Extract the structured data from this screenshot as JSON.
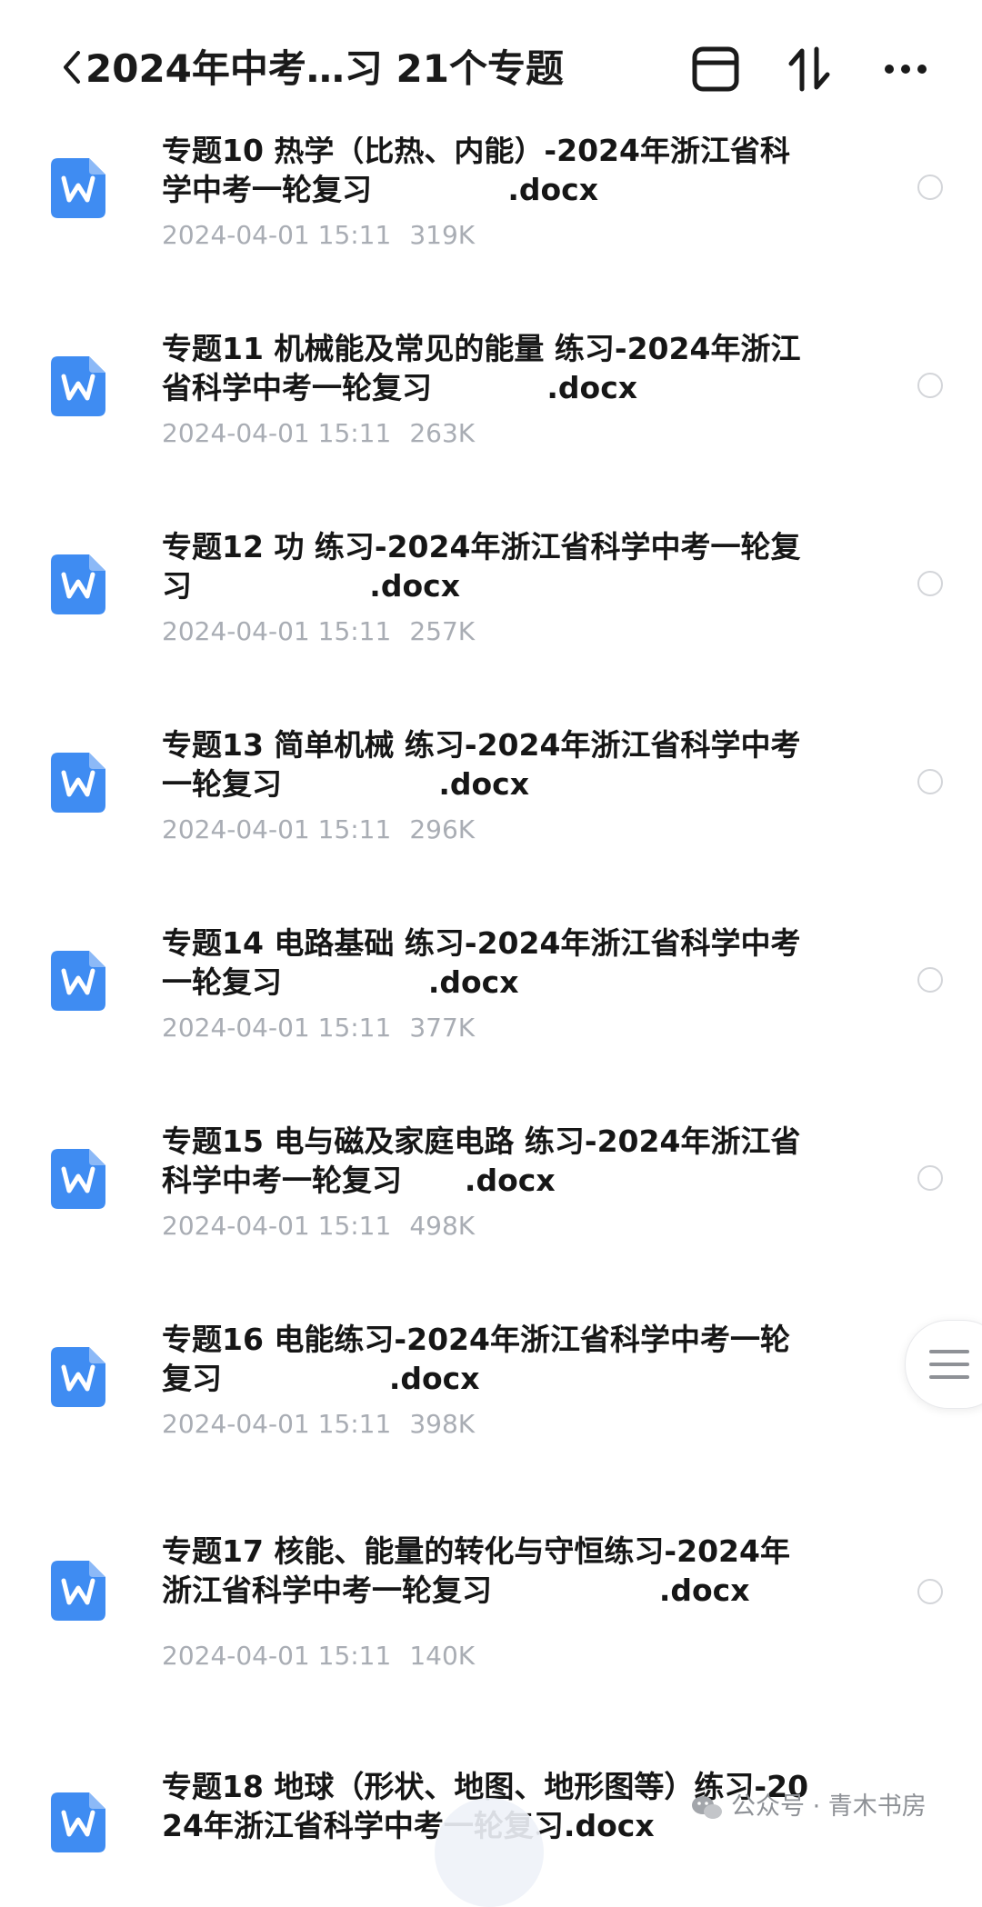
{
  "header": {
    "title": "2024年中考…习 21个专题"
  },
  "files": [
    {
      "name": "专题10 热学（比热、内能）-2024年浙江省科学中考一轮复习             .docx",
      "date": "2024-04-01 15:11",
      "size": "319K"
    },
    {
      "name": "专题11 机械能及常见的能量 练习-2024年浙江省科学中考一轮复习           .docx",
      "date": "2024-04-01 15:11",
      "size": "263K"
    },
    {
      "name": "专题12 功 练习-2024年浙江省科学中考一轮复习                 .docx",
      "date": "2024-04-01 15:11",
      "size": "257K"
    },
    {
      "name": "专题13 简单机械 练习-2024年浙江省科学中考一轮复习               .docx",
      "date": "2024-04-01 15:11",
      "size": "296K"
    },
    {
      "name": "专题14 电路基础 练习-2024年浙江省科学中考一轮复习              .docx",
      "date": "2024-04-01 15:11",
      "size": "377K"
    },
    {
      "name": "专题15 电与磁及家庭电路 练习-2024年浙江省科学中考一轮复习      .docx",
      "date": "2024-04-01 15:11",
      "size": "498K"
    },
    {
      "name": "专题16 电能练习-2024年浙江省科学中考一轮复习                .docx",
      "date": "2024-04-01 15:11",
      "size": "398K"
    },
    {
      "name": "专题17 核能、能量的转化与守恒练习-2024年浙江省科学中考一轮复习                .docx",
      "date": "2024-04-01 15:11",
      "size": "140K"
    },
    {
      "name": "专题18 地球（形状、地图、地形图等）练习-2024年浙江省科学中考一轮复习.docx",
      "date": "",
      "size": ""
    }
  ],
  "watermark": {
    "text": "公众号 · 青木书房"
  },
  "icons": {
    "file": "word-docx-icon",
    "back": "chevron-left-icon",
    "window": "window-icon",
    "sort": "sort-icon",
    "more": "more-icon",
    "menu": "hamburger-menu-icon"
  },
  "colors": {
    "word_blue": "#3f8cf2",
    "meta_gray": "#a9adb4",
    "radio_border": "#d3d5d9"
  }
}
